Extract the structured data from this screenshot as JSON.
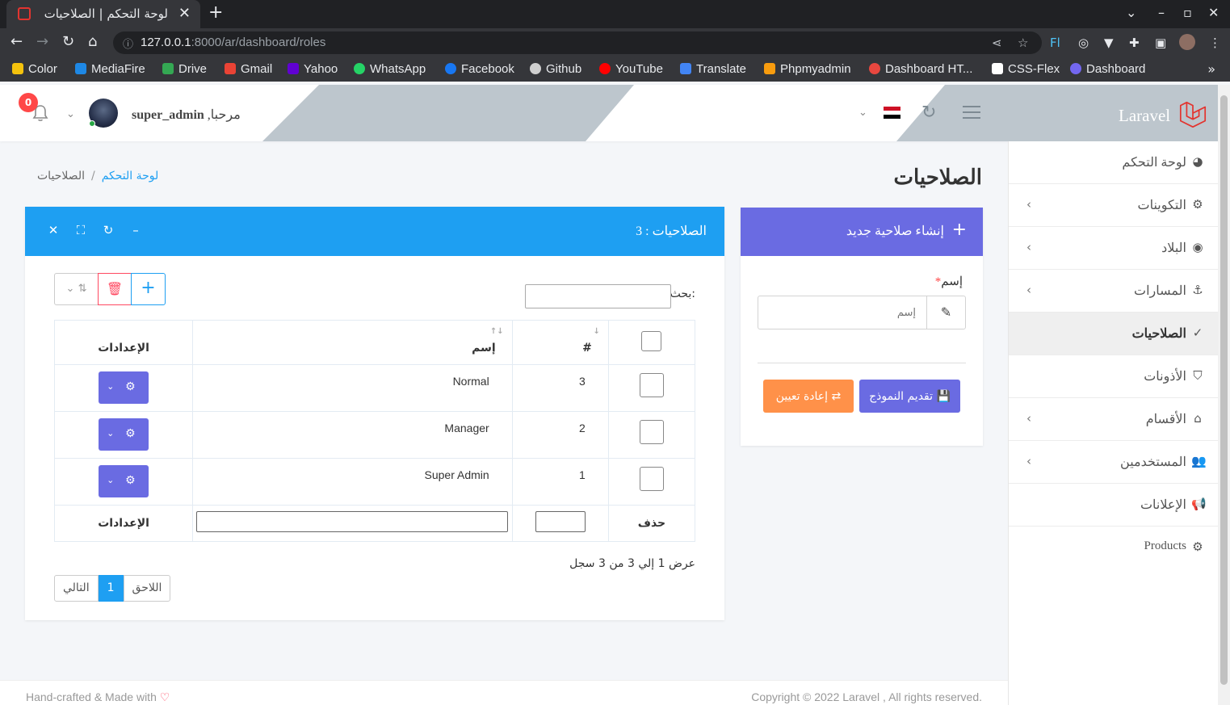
{
  "browser": {
    "tab_title": "لوحة التحكم | الصلاحيات",
    "url_host": "127.0.0.1",
    "url_path": ":8000/ar/dashboard/roles",
    "bookmarks": [
      {
        "label": "Color",
        "color": "#f4c20d"
      },
      {
        "label": "MediaFire",
        "color": "#1e88e5"
      },
      {
        "label": "Drive",
        "color": "#34a853"
      },
      {
        "label": "Gmail",
        "color": "#ea4335"
      },
      {
        "label": "Yahoo",
        "color": "#6001d2"
      },
      {
        "label": "WhatsApp",
        "color": "#25d366"
      },
      {
        "label": "Facebook",
        "color": "#1877f2"
      },
      {
        "label": "Github",
        "color": "#cfcfcf"
      },
      {
        "label": "YouTube",
        "color": "#ff0000"
      },
      {
        "label": "Translate",
        "color": "#4285f4"
      },
      {
        "label": "Phpmyadmin",
        "color": "#f89c0e"
      },
      {
        "label": "Dashboard HT...",
        "color": "#e8473f"
      },
      {
        "label": "CSS-Flex",
        "color": "#ffffff"
      },
      {
        "label": "Dashboard",
        "color": "#7367f0"
      }
    ]
  },
  "header": {
    "brand": "Laravel",
    "brand_color": "#e3342f",
    "greeting": "مرحبا,",
    "username": "super_admin",
    "notifications_count": "0"
  },
  "sidebar": {
    "items": [
      {
        "label": "لوحة التحكم",
        "icon": "dashboard-icon",
        "chevron": false
      },
      {
        "label": "التكوينات",
        "icon": "gears-icon",
        "chevron": true
      },
      {
        "label": "البلاد",
        "icon": "globe-icon",
        "chevron": true
      },
      {
        "label": "المسارات",
        "icon": "anchor-icon",
        "chevron": true
      },
      {
        "label": "الصلاحيات",
        "icon": "check-icon",
        "chevron": false,
        "active": true
      },
      {
        "label": "الأذونات",
        "icon": "shield-icon",
        "chevron": false
      },
      {
        "label": "الأقسام",
        "icon": "home-icon",
        "chevron": true
      },
      {
        "label": "المستخدمين",
        "icon": "users-icon",
        "chevron": true
      },
      {
        "label": "الإعلانات",
        "icon": "bullhorn-icon",
        "chevron": false
      },
      {
        "label": "Products",
        "icon": "gears-icon",
        "chevron": false
      }
    ]
  },
  "page": {
    "title": "الصلاحيات",
    "breadcrumb_home": "لوحة التحكم",
    "breadcrumb_current": "الصلاحيات"
  },
  "form": {
    "title": "إنشاء صلاحية جديد",
    "name_label": "إسم",
    "name_placeholder": "إسم",
    "submit_label": "تقديم النموذج",
    "reset_label": "إعادة تعيين"
  },
  "table": {
    "title": "الصلاحيات : 3",
    "search_label": "بحث:",
    "columns": {
      "id": "#",
      "name": "إسم",
      "settings": "الإعدادات"
    },
    "rows": [
      {
        "id": "3",
        "name": "Normal"
      },
      {
        "id": "2",
        "name": "Manager"
      },
      {
        "id": "1",
        "name": "Super Admin"
      }
    ],
    "footer_delete": "حذف",
    "footer_settings": "الإعدادات",
    "info": "عرض 1 إلي 3 من 3 سجل",
    "pagination": {
      "next": "اللاحق",
      "current": "1",
      "prev": "التالي"
    }
  },
  "footer": {
    "left": "Hand-crafted & Made with",
    "right": "Copyright © 2022 Laravel , All rights reserved."
  }
}
